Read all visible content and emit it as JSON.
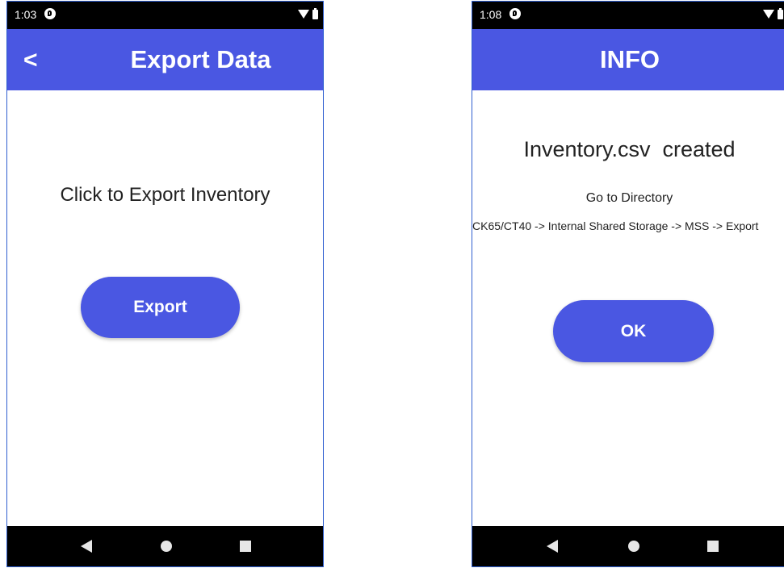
{
  "left_screen": {
    "status": {
      "time": "1:03"
    },
    "header": {
      "back_label": "<",
      "title": "Export Data"
    },
    "main": {
      "prompt": "Click to Export Inventory",
      "export_button_label": "Export"
    }
  },
  "right_screen": {
    "status": {
      "time": "1:08"
    },
    "header": {
      "title": "INFO"
    },
    "main": {
      "message": "Inventory.csv  created",
      "directory_label": "Go to Directory",
      "path": "CK65/CT40 -> Internal Shared Storage -> MSS -> Export",
      "ok_button_label": "OK"
    }
  },
  "colors": {
    "accent": "#4a57e2",
    "bars": "#000000",
    "frame": "#2f5fd0"
  },
  "icons": [
    "notification-icon",
    "wifi-icon",
    "battery-icon",
    "nav-back-icon",
    "nav-home-icon",
    "nav-recents-icon"
  ]
}
